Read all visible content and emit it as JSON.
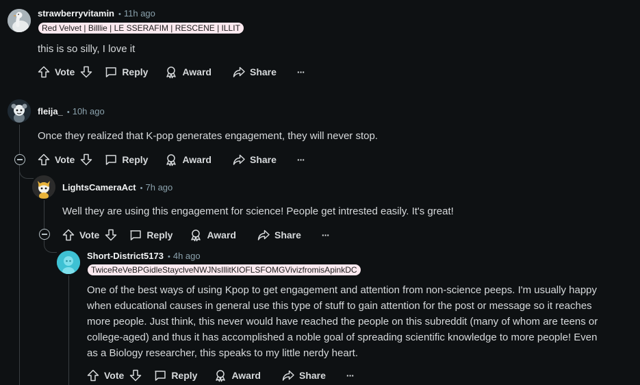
{
  "comments": [
    {
      "username": "strawberryvitamin",
      "time": "11h ago",
      "flair": "Red Velvet | Billlie | LE SSERAFIM | RESCENE | ILLIT",
      "body": "this is so silly, I love it",
      "vote_label": "Vote",
      "reply_label": "Reply",
      "award_label": "Award",
      "share_label": "Share",
      "avatar_icon": "goose-avatar-icon"
    },
    {
      "username": "fleija_",
      "time": "10h ago",
      "body": "Once they realized that K-pop generates engagement, they will never stop.",
      "vote_label": "Vote",
      "reply_label": "Reply",
      "award_label": "Award",
      "share_label": "Share",
      "avatar_icon": "snoo-avatar-icon"
    },
    {
      "username": "LightsCameraAct",
      "time": "7h ago",
      "body": "Well they are using this engagement for science! People get intrested easily. It's great!",
      "vote_label": "Vote",
      "reply_label": "Reply",
      "award_label": "Award",
      "share_label": "Share",
      "avatar_icon": "snoo-avatar-icon"
    },
    {
      "username": "Short-District5173",
      "time": "4h ago",
      "flair": "TwiceReVeBPGidleStayclveNWJNsIllitKIOFLSFOMGVivizfromisApinkDC",
      "body_lines": [
        "One of the best ways of using Kpop to get engagement and attention from non-science peeps. I'm usually happy",
        "when educational causes in general use this type of stuff to gain attention for the post or message so it reaches",
        "more people. Just think, this never would have reached the people on this subreddit (many of whom are teens or",
        "college-aged) and thus it has accomplished a noble goal of spreading scientific knowledge to more people! Even",
        "as a Biology researcher, this speaks to my little nerdy heart."
      ],
      "vote_label": "Vote",
      "reply_label": "Reply",
      "award_label": "Award",
      "share_label": "Share",
      "avatar_icon": "default-snoo-avatar-icon"
    }
  ],
  "colors": {
    "background": "#0e1113",
    "text": "#d7dadc",
    "meta": "#8ba2ad",
    "flair_bg": "#fbe9ef",
    "avatar_cyan": "#3ec1d3"
  },
  "dot": "•",
  "more_label": "···"
}
